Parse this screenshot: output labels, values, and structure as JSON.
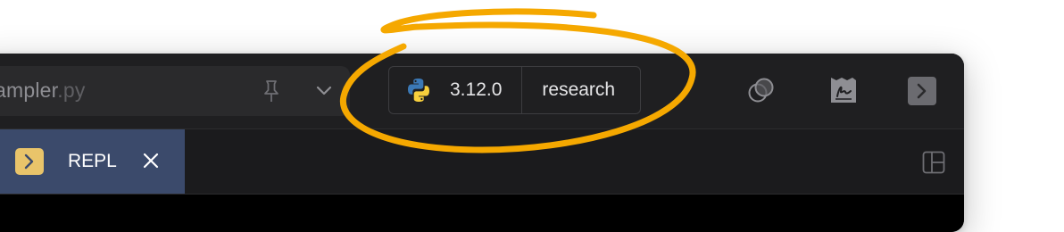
{
  "toolbar": {
    "file_name_stem": "ampler",
    "file_name_ext": ".py",
    "environment": {
      "python_version": "3.12.0",
      "name": "research"
    }
  },
  "tabs": [
    {
      "label": "REPL",
      "active": true
    }
  ],
  "colors": {
    "annotation": "#f5a800",
    "tab_active_bg": "#3b4a6b",
    "tab_icon_bg": "#e9c46a",
    "window_bg": "#1b1b1d"
  },
  "icons": {
    "pin": "pin-icon",
    "dropdown": "chevron-down-icon",
    "python": "python-icon",
    "compare": "circles-overlap-icon",
    "signature": "signature-icon",
    "terminal": "terminal-icon",
    "close": "close-icon",
    "layout": "layout-icon"
  }
}
